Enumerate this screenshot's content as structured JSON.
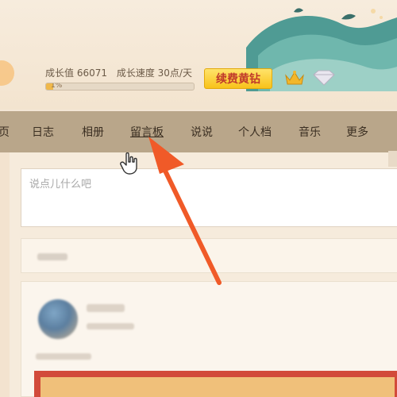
{
  "header": {
    "growth_value": "成长值 66071",
    "growth_speed": "成长速度 30点/天",
    "progress_label": "1%",
    "progress_fraction": 0.05,
    "renew_button": "续费黄钻"
  },
  "nav": {
    "items": [
      "页",
      "日志",
      "相册",
      "留言板",
      "说说",
      "个人档",
      "音乐",
      "更多"
    ],
    "active": "留言板"
  },
  "composer": {
    "placeholder": "说点儿什么吧"
  },
  "colors": {
    "nav_bg": "#b9a68a",
    "accent_arrow": "#f05a28",
    "button_bg": "#f8c21a",
    "button_text": "#c0392b"
  },
  "icons": [
    "sun-icon",
    "crown-icon",
    "diamond-icon",
    "hand-cursor-icon",
    "arrow-annotation-icon"
  ]
}
